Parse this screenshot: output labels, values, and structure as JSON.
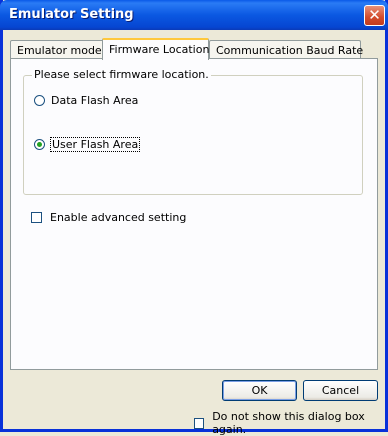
{
  "window": {
    "title": "Emulator Setting",
    "close_glyph": "✕"
  },
  "tabs": [
    {
      "label": "Emulator mode",
      "active": false
    },
    {
      "label": "Firmware Location",
      "active": true
    },
    {
      "label": "Communication Baud Rate",
      "active": false
    }
  ],
  "firmware_group": {
    "legend": "Please select firmware location.",
    "options": [
      {
        "label": "Data Flash Area",
        "selected": false
      },
      {
        "label": "User Flash Area",
        "selected": true
      }
    ]
  },
  "advanced": {
    "label": "Enable advanced setting",
    "checked": false
  },
  "buttons": {
    "ok": "OK",
    "cancel": "Cancel"
  },
  "footer": {
    "dont_show_label": "Do not show this dialog box again.",
    "checked": false
  },
  "colors": {
    "titlebar": "#0a5ae8",
    "frame": "#0831d9",
    "dialog_bg": "#ece9d8",
    "panel_bg": "#fcfcfe",
    "active_tab_accent": "#ffc83c"
  }
}
